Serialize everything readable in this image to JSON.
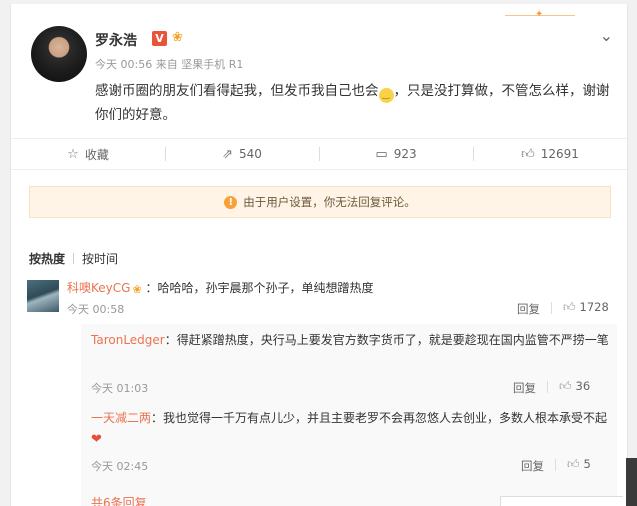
{
  "post": {
    "author": "罗永浩",
    "v_badge": "V",
    "time": "今天 00:56",
    "source_prefix": "来自",
    "source": "坚果手机 R1",
    "text_part1": "感谢币圈的朋友们看得起我，但发币我自己也会",
    "text_part2": "，只是没打算做，不管怎么样，谢谢你们的好意。"
  },
  "actions": {
    "favorite": "收藏",
    "forward_count": "540",
    "comment_count": "923",
    "like_count": "12691"
  },
  "notice": "由于用户设置，你无法回复评论。",
  "sort": {
    "hot": "按热度",
    "time": "按时间"
  },
  "comment": {
    "user": "科噢KeyCG",
    "text": "：哈哈哈，孙宇晨那个孙子，单纯想蹭热度",
    "time": "今天 00:58",
    "reply_label": "回复",
    "likes": "1728"
  },
  "subcomments": [
    {
      "user": "TaronLedger",
      "text": "：得赶紧蹭热度，央行马上要发官方数字货币了，就是要趁现在国内监管不严捞一笔",
      "time": "今天 01:03",
      "reply_label": "回复",
      "likes": "36"
    },
    {
      "user": "一天减二两",
      "text": "：我也觉得一千万有点儿少，并且主要老罗不会再忽悠人去创业，多数人根本承受不起",
      "time": "今天 02:45",
      "reply_label": "回复",
      "likes": "5"
    }
  ],
  "more_replies": "共6条回复",
  "colors": {
    "link": "#eb7350",
    "notice_bg": "#fff4e5",
    "badge": "#e8543a"
  }
}
